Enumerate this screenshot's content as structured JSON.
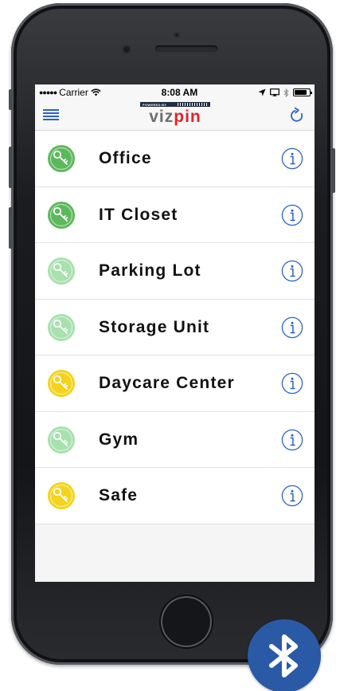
{
  "status_bar": {
    "signal": "●●●●●",
    "carrier": "Carrier",
    "time": "8:08 AM",
    "battery_level": 0.85
  },
  "nav": {
    "logo_tagline": "POWERED BY",
    "logo_part1": "viz",
    "logo_part2": "pin",
    "menu_icon": "hamburger-menu-icon",
    "refresh_icon": "refresh-icon"
  },
  "locks": [
    {
      "label": "Office",
      "status": "in-range",
      "color": "#5cb85c"
    },
    {
      "label": "IT Closet",
      "status": "in-range",
      "color": "#5cb85c"
    },
    {
      "label": "Parking Lot",
      "status": "out-of-range",
      "color": "#a8e0ae"
    },
    {
      "label": "Storage Unit",
      "status": "out-of-range",
      "color": "#a8e0ae"
    },
    {
      "label": "Daycare Center",
      "status": "restricted",
      "color": "#f3d31d"
    },
    {
      "label": "Gym",
      "status": "out-of-range",
      "color": "#a8e0ae"
    },
    {
      "label": "Safe",
      "status": "restricted",
      "color": "#f3d31d"
    }
  ],
  "colors": {
    "accent": "#2b62c4",
    "bluetooth": "#2a5aa6",
    "logo_grey": "#6e6e6e",
    "logo_red": "#e5212b"
  },
  "badge_icon": "bluetooth-icon"
}
